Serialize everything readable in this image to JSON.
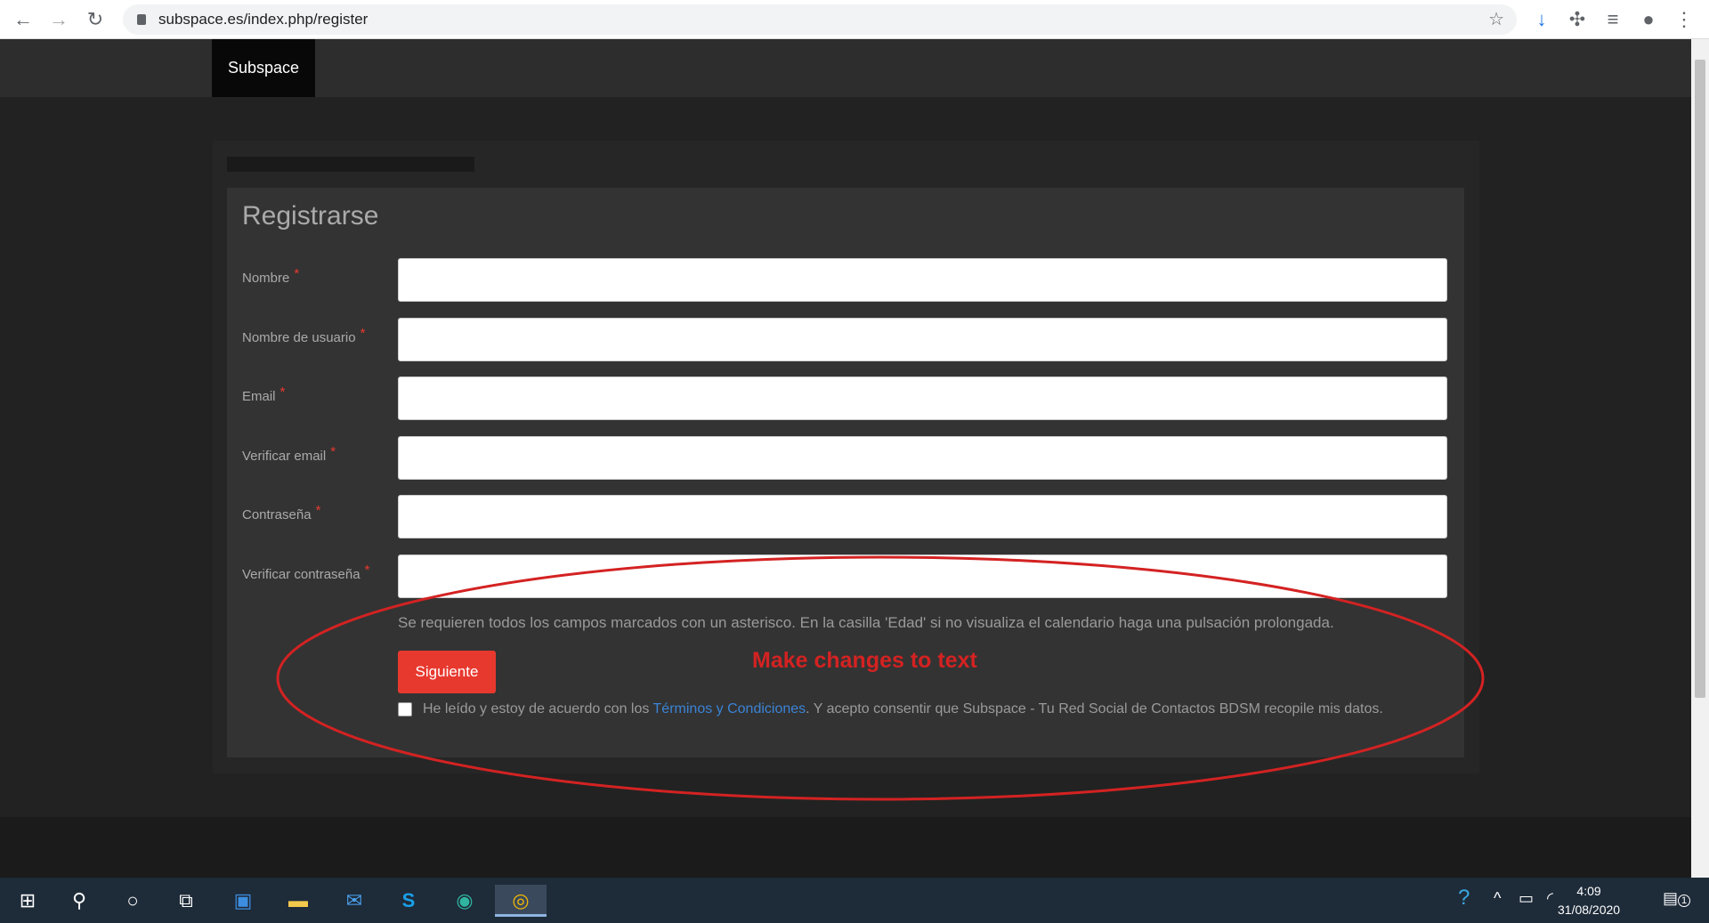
{
  "browser": {
    "url": "subspace.es/index.php/register"
  },
  "nav": {
    "brand": "Subspace"
  },
  "form": {
    "title": "Registrarse",
    "fields": [
      {
        "label": "Nombre",
        "value": ""
      },
      {
        "label": "Nombre de usuario",
        "value": ""
      },
      {
        "label": "Email",
        "value": ""
      },
      {
        "label": "Verificar email",
        "value": ""
      },
      {
        "label": "Contraseña",
        "value": ""
      },
      {
        "label": "Verificar contraseña",
        "value": ""
      }
    ],
    "required_mark": "*",
    "help": "Se requieren todos los campos marcados con un asterisco. En la casilla 'Edad' si no visualiza el calendario haga una pulsación prolongada.",
    "submit": "Siguiente",
    "terms_pre": "He leído y estoy de acuerdo con los ",
    "terms_link": "Términos y Condiciones",
    "terms_post": ". Y acepto consentir que Subspace - Tu Red Social de Contactos BDSM recopile mis datos.",
    "terms_checked": false
  },
  "annotation": {
    "text": "Make changes to text",
    "color": "#d42222"
  },
  "taskbar": {
    "time": "4:09",
    "date": "31/08/2020",
    "notifications": "1"
  }
}
